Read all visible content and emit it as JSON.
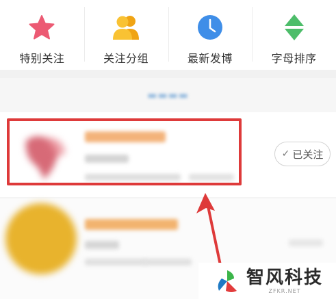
{
  "categories": [
    {
      "label": "特别关注",
      "icon": "star-icon",
      "color": "#ec5a73"
    },
    {
      "label": "关注分组",
      "icon": "group-icon",
      "color": "#f7b324"
    },
    {
      "label": "最新发博",
      "icon": "clock-icon",
      "color": "#3f8ee8"
    },
    {
      "label": "字母排序",
      "icon": "diamond-icon",
      "color": "#4dbd6a"
    }
  ],
  "follow_button": {
    "check": "✓",
    "label": "已关注"
  },
  "highlight_color": "#de3a3a",
  "watermark": {
    "name": "智风科技",
    "url": "ZFKR.NET"
  }
}
